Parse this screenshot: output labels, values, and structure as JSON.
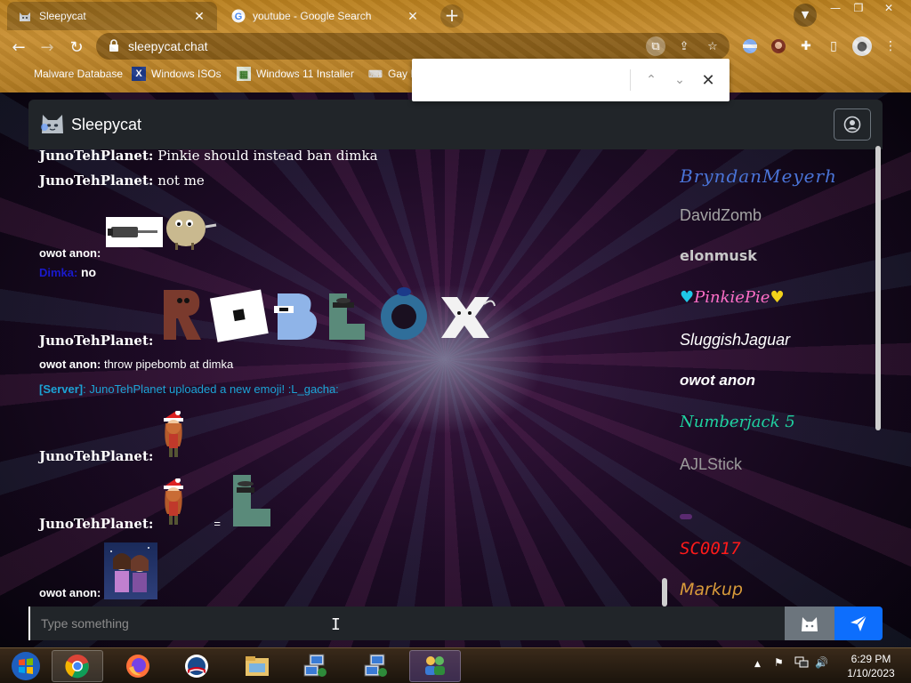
{
  "browser": {
    "tabs": [
      {
        "title": "Sleepycat",
        "favicon": "cat-favicon-icon",
        "active": true
      },
      {
        "title": "youtube - Google Search",
        "favicon": "google-favicon-icon",
        "active": false
      }
    ],
    "url": "sleepycat.chat",
    "bookmarks": [
      {
        "label": "Malware Database"
      },
      {
        "label": "Windows ISOs"
      },
      {
        "label": "Windows 11 Installer"
      },
      {
        "label": "Gay I"
      }
    ],
    "find_bar": {
      "query": ""
    }
  },
  "app": {
    "brand": "Sleepycat",
    "messages": [
      {
        "user": "JunoTehPlanet:",
        "text": "Pinkie should instead ban dimka"
      },
      {
        "user": "JunoTehPlanet:",
        "text": "not me"
      },
      {
        "user": "owot anon:",
        "text": ""
      },
      {
        "user": "Dimka:",
        "text": "no"
      },
      {
        "user": "JunoTehPlanet:",
        "text": ""
      },
      {
        "user": "owot anon:",
        "text": "throw pipebomb at dimka"
      },
      {
        "user": "[Server]",
        "text": ": JunoTehPlanet uploaded a new emoji! :L_gacha:"
      },
      {
        "user": "JunoTehPlanet:",
        "text": ""
      },
      {
        "user": "JunoTehPlanet:",
        "text": "="
      },
      {
        "user": "owot anon:",
        "text": ""
      }
    ],
    "users": [
      {
        "name": "BryndanMeyerh",
        "color": "#4a74d8"
      },
      {
        "name": "DavidZomb",
        "color": "#a4a4a4"
      },
      {
        "name": "elonmusk",
        "color": "#c8c8c8"
      },
      {
        "name": "PinkiePie",
        "color": "#ff6ec7"
      },
      {
        "name": "SluggishJaguar",
        "color": "#ffffff"
      },
      {
        "name": "owot anon",
        "color": "#ffffff"
      },
      {
        "name": "Numberjack 5",
        "color": "#1fd1a0"
      },
      {
        "name": "AJLStick",
        "color": "#9a9a9a"
      },
      {
        "name": "",
        "color": "#5a2a70"
      },
      {
        "name": "SC0017",
        "color": "#ff1a1a"
      },
      {
        "name": "Markup",
        "color": "#d89b3a"
      }
    ],
    "input": {
      "placeholder": "Type something",
      "value": ""
    }
  },
  "taskbar": {
    "apps": [
      "windows-start-icon",
      "chrome-icon",
      "firefox-icon",
      "obama-icon",
      "file-explorer-icon",
      "network-computer-icon",
      "network-computer-icon",
      "network-users-icon"
    ],
    "time": "6:29 PM",
    "date": "1/10/2023"
  },
  "colors": {
    "accent": "#0d6efd",
    "server": "#1ca3d6",
    "dimka": "#1a1acc",
    "header": "#212529"
  }
}
